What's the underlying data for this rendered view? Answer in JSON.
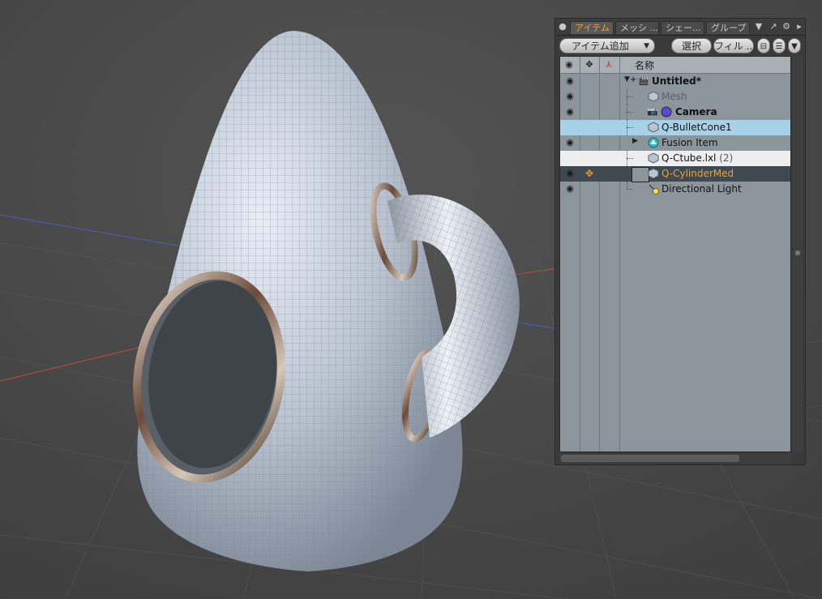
{
  "panel": {
    "tabs": [
      {
        "label": "アイテム",
        "active": true
      },
      {
        "label": "メッシ ...",
        "active": false
      },
      {
        "label": "シェー...",
        "active": false
      },
      {
        "label": "グループ",
        "active": false
      }
    ],
    "toolbar": {
      "add_item": "アイテム追加",
      "select": "選択",
      "filter": "フィル ..."
    },
    "columns": {
      "visibility_icon": "eye-icon",
      "transform_icon": "move-icon",
      "axis_icon": "axis-icon",
      "name": "名称"
    },
    "items": [
      {
        "label": "Untitled*",
        "icon": "scene-icon",
        "bold": true,
        "visible": true
      },
      {
        "label": "Mesh",
        "icon": "mesh-icon",
        "dim": true,
        "visible": true
      },
      {
        "label": "Camera",
        "icon": "camera-icon",
        "bold": true,
        "visible": true
      },
      {
        "label": "Q-BulletCone1",
        "icon": "mesh-icon",
        "selected": true,
        "visible": false
      },
      {
        "label": "Fusion Item",
        "icon": "fusion-icon",
        "visible": true
      },
      {
        "label": "Q-Ctube.lxl",
        "suffix": "(2)",
        "icon": "mesh-icon",
        "highlight": true,
        "visible": false
      },
      {
        "label": "Q-CylinderMed",
        "icon": "mesh-icon",
        "active": true,
        "visible": true
      },
      {
        "label": "Directional Light",
        "icon": "light-icon",
        "visible": true
      }
    ]
  },
  "colors": {
    "accent": "#f0a030",
    "list_bg": "#8d959c",
    "selected_row": "#a8d0e6",
    "active_row": "#404850"
  }
}
